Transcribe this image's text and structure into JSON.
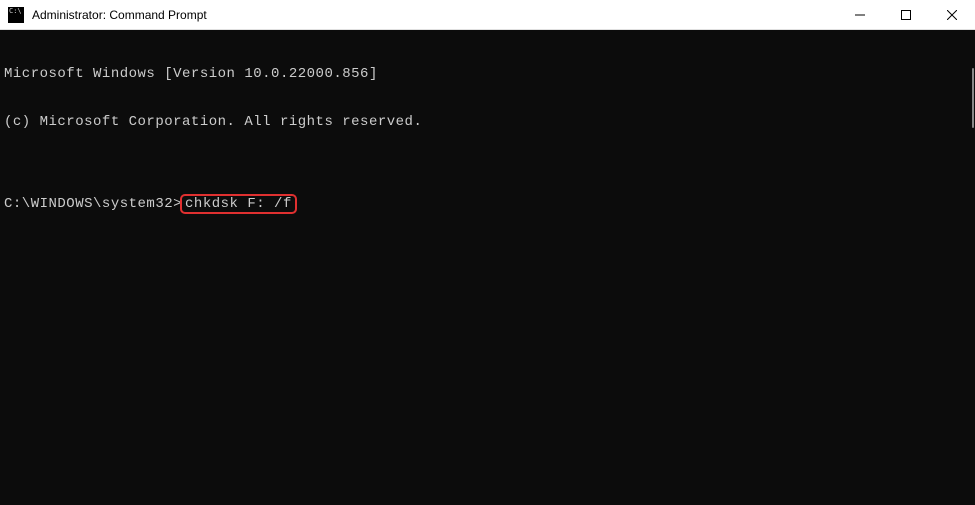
{
  "window": {
    "title": "Administrator: Command Prompt"
  },
  "terminal": {
    "line1": "Microsoft Windows [Version 10.0.22000.856]",
    "line2": "(c) Microsoft Corporation. All rights reserved.",
    "blank": "",
    "prompt": "C:\\WINDOWS\\system32>",
    "command": "chkdsk F: /f"
  },
  "colors": {
    "highlight_border": "#e03030",
    "terminal_bg": "#0c0c0c",
    "terminal_fg": "#cccccc"
  }
}
